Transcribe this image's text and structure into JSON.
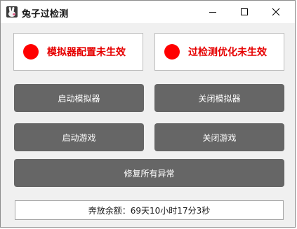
{
  "window": {
    "title": "兔子过检测",
    "icon": "rabbit-icon",
    "controls": {
      "minimize": "minimize-icon",
      "maximize": "maximize-icon",
      "close": "close-icon"
    }
  },
  "status": {
    "emulator": {
      "text": "模拟器配置未生效",
      "indicator_color": "#ff0000"
    },
    "detection": {
      "text": "过检测优化未生效",
      "indicator_color": "#ff0000"
    }
  },
  "buttons": {
    "start_emulator": "启动模拟器",
    "close_emulator": "关闭模拟器",
    "start_game": "启动游戏",
    "close_game": "关闭游戏",
    "repair_all": "修复所有异常"
  },
  "balance": {
    "text": "奔放余额：69天10小时17分3秒"
  },
  "colors": {
    "status_text": "#e60000",
    "button_bg": "#666666",
    "button_text": "#ffffff"
  }
}
